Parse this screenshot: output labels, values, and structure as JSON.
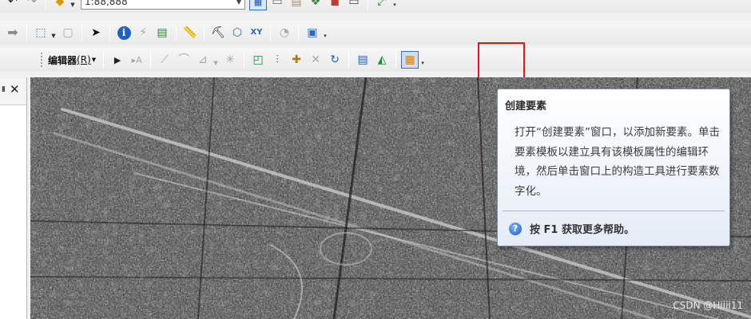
{
  "toolbar_top": {
    "scale_value": "1:88,888",
    "icons": [
      "back-icon",
      "forward-icon",
      "pan-icon",
      "scale-dropdown",
      "select-elements-icon",
      "table-icon",
      "catalog-icon",
      "search-icon",
      "toolbox-icon",
      "python-icon",
      "arcmap-icon"
    ]
  },
  "toolbar_tools": {
    "icons": [
      "go-forward-icon",
      "select-features-icon",
      "clear-selection-icon",
      "select-elements-icon",
      "identify-icon",
      "hyperlink-icon",
      "html-popup-icon",
      "measure-icon",
      "find-icon",
      "find-route-icon",
      "goto-xy-icon",
      "time-slider-icon",
      "create-viewer-icon"
    ]
  },
  "toolbar_editor": {
    "menu_label": "编辑器",
    "menu_mnemonic": "(R)",
    "icons": [
      "edit-tool-icon",
      "edit-annotation-icon",
      "straight-segment-icon",
      "end-point-arc-icon",
      "trace-icon",
      "point-icon",
      "edit-vertices-icon",
      "reshape-icon",
      "cut-polygons-icon",
      "split-icon",
      "rotate-icon",
      "attributes-icon",
      "sketch-properties-icon",
      "create-features-icon"
    ]
  },
  "tooltip": {
    "title": "创建要素",
    "body": "打开“创建要素”窗口，以添加新要素。单击要素模板以建立具有该模板属性的编辑环境，然后单击窗口上的构造工具进行要素数字化。",
    "help": "按 F1 获取更多帮助。"
  },
  "watermark": "CSDN @Hiiii11",
  "colors": {
    "highlight_border": "#e01818",
    "tooltip_border": "#7a8ea8",
    "help_icon": "#1f57c4"
  }
}
